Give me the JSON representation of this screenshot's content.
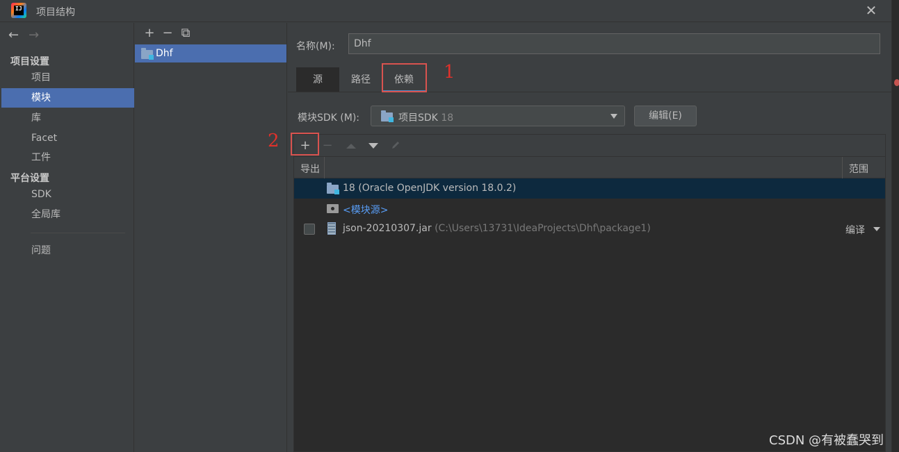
{
  "window": {
    "title": "项目结构",
    "close_glyph": "✕",
    "logo_text": "IJ"
  },
  "sidebar": {
    "back_glyph": "←",
    "forward_glyph": "→",
    "project_settings_header": "项目设置",
    "project_settings": [
      {
        "label": "项目"
      },
      {
        "label": "模块",
        "selected": true
      },
      {
        "label": "库"
      },
      {
        "label": "Facet"
      },
      {
        "label": "工件"
      }
    ],
    "platform_settings_header": "平台设置",
    "platform_settings": [
      {
        "label": "SDK"
      },
      {
        "label": "全局库"
      }
    ],
    "problems_label": "问题"
  },
  "module_panel": {
    "toolbar": {
      "add": "+",
      "remove": "−",
      "copy": "⧉"
    },
    "modules": [
      {
        "name": "Dhf",
        "selected": true
      }
    ]
  },
  "main": {
    "name_label": "名称(M):",
    "name_value": "Dhf",
    "tabs": [
      {
        "label": "源"
      },
      {
        "label": "路径"
      },
      {
        "label": "依赖",
        "active": true
      }
    ],
    "sdk_label": "模块SDK (M):",
    "sdk_value": "项目SDK",
    "sdk_version": "18",
    "edit_button": "编辑(E)",
    "toolbar": {
      "add": "+",
      "remove": "−"
    },
    "columns": {
      "export": "导出",
      "scope": "范围"
    },
    "dependencies": [
      {
        "name": "18 (Oracle OpenJDK version 18.0.2)",
        "type": "sdk",
        "selected": true
      },
      {
        "name": "<模块源>",
        "type": "module-source"
      },
      {
        "name": "json-20210307.jar",
        "path": "(C:\\Users\\13731\\IdeaProjects\\Dhf\\package1)",
        "type": "jar",
        "scope": "编译",
        "exported": false
      }
    ]
  },
  "annotations": {
    "num1": "1",
    "num2": "2"
  },
  "watermark": "CSDN @有被蠢哭到",
  "colors": {
    "background": "#3c3f41",
    "selection": "#4b6eaf",
    "table_selection": "#0d293e",
    "link": "#589df6",
    "annotation_red": "#e0312b"
  }
}
